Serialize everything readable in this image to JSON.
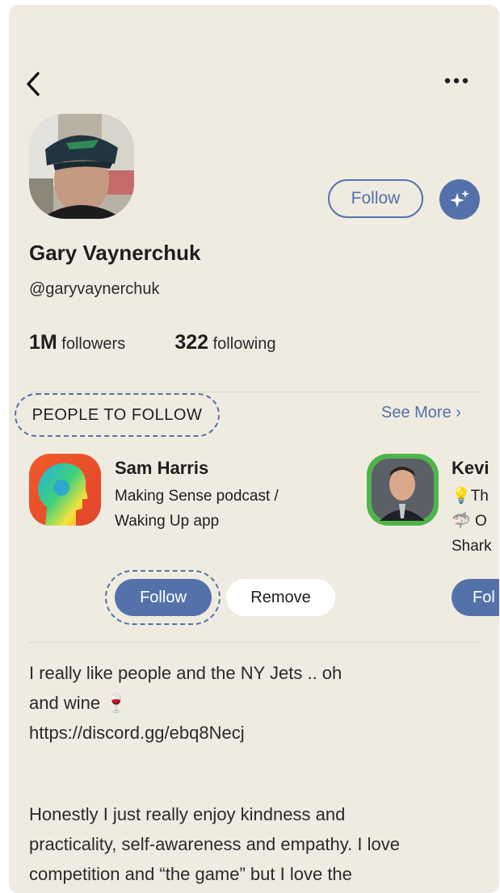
{
  "header": {
    "back_icon": "chevron-left-icon",
    "more_icon": "more-horizontal-icon"
  },
  "profile": {
    "name": "Gary Vaynerchuk",
    "handle": "@garyvaynerchuk",
    "followers_count": "1M",
    "followers_label": "followers",
    "following_count": "322",
    "following_label": "following",
    "follow_label": "Follow",
    "sparkle_icon": "sparkles-icon"
  },
  "people_to_follow": {
    "title": "PEOPLE TO FOLLOW",
    "see_more": "See More ›",
    "suggestions": [
      {
        "name": "Sam Harris",
        "bio_line1": "Making Sense podcast /",
        "bio_line2": "Waking Up app",
        "follow_label": "Follow",
        "remove_label": "Remove"
      },
      {
        "name": "Kevi",
        "bio_line1": "Th",
        "bio_line2": "O",
        "bio_line3": "Shark",
        "follow_label": "Fol"
      }
    ]
  },
  "bio": {
    "line1": "I really like people and the NY Jets .. oh",
    "line2": "and wine 🍷",
    "line3": "https://discord.gg/ebq8Necj",
    "line4": "Honestly I just really enjoy kindness and",
    "line5": "practicality, self-awareness and empathy. I love",
    "line6": "competition and “the game” but I love the"
  },
  "colors": {
    "background": "#f0ebe1",
    "accent": "#5472a9",
    "text": "#1e1e1e"
  }
}
